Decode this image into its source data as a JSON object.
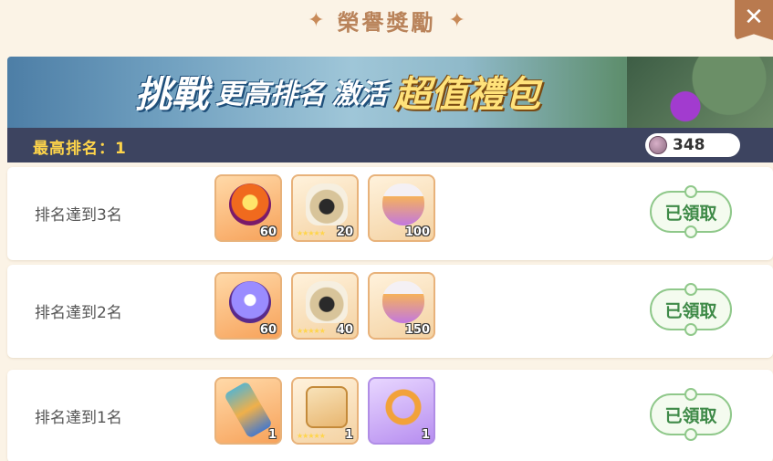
{
  "header": {
    "title": "榮譽獎勵",
    "star_glyph": "✦",
    "close_glyph": "✕"
  },
  "banner": {
    "part1": "挑戰",
    "part2": "更高排名",
    "part3": "激活",
    "part4": "超值禮包"
  },
  "rank": {
    "label": "最高排名：1",
    "currency_value": "348"
  },
  "rewards": [
    {
      "label": "排名達到3名",
      "items": [
        {
          "icon": "fire-orb-icon",
          "count": "60",
          "style": "orange",
          "stars": ""
        },
        {
          "icon": "helmet-shard-icon",
          "count": "20",
          "style": "cream",
          "stars": "★★★★★"
        },
        {
          "icon": "potion-flask-icon",
          "count": "100",
          "style": "cream",
          "stars": ""
        }
      ],
      "status": "已領取"
    },
    {
      "label": "排名達到2名",
      "items": [
        {
          "icon": "crystal-orb-icon",
          "count": "60",
          "style": "orange",
          "stars": ""
        },
        {
          "icon": "helmet-shard-icon",
          "count": "40",
          "style": "cream",
          "stars": "★★★★★"
        },
        {
          "icon": "potion-flask-icon",
          "count": "150",
          "style": "cream",
          "stars": ""
        }
      ],
      "status": "已領取"
    },
    {
      "label": "排名達到1名",
      "items": [
        {
          "icon": "bracer-icon",
          "count": "1",
          "style": "orange",
          "stars": ""
        },
        {
          "icon": "scroll-shard-icon",
          "count": "1",
          "style": "cream",
          "stars": "★★★★★"
        },
        {
          "icon": "fire-ring-icon",
          "count": "1",
          "style": "purple",
          "stars": ""
        }
      ],
      "status": "已領取"
    }
  ],
  "colors": {
    "background": "#fbf3e6",
    "rank_bar": "#3d4460",
    "rank_text": "#ffd54a",
    "claim_green": "#3f8a48"
  }
}
